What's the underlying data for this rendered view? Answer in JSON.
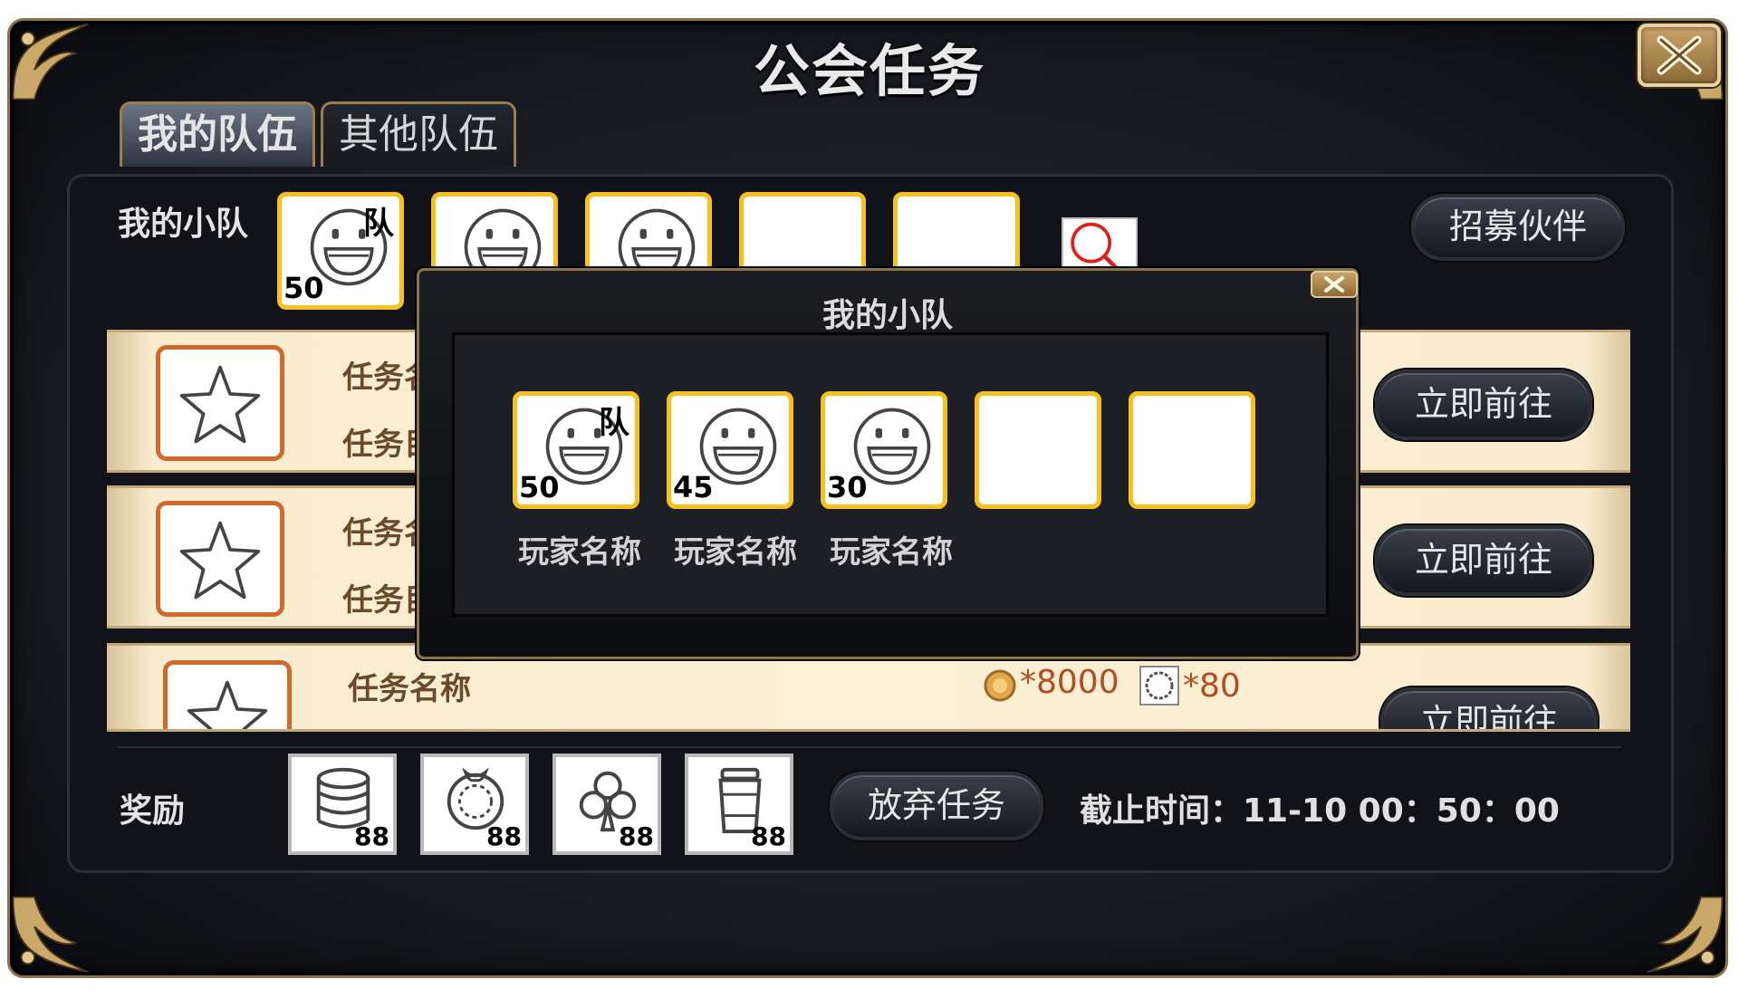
{
  "window": {
    "title": "公会任务",
    "close_icon": "close-x-icon"
  },
  "tabs": [
    {
      "label": "我的队伍",
      "active": true
    },
    {
      "label": "其他队伍",
      "active": false
    }
  ],
  "team": {
    "label": "我的小队",
    "slots": [
      {
        "level": "50",
        "captain": "队",
        "icon": "smiley-face-icon"
      },
      {
        "icon": "smiley-face-icon"
      },
      {
        "icon": "smiley-face-icon"
      },
      {},
      {}
    ],
    "search_icon": "search-icon",
    "recruit_button": "招募伙伴"
  },
  "tasks": [
    {
      "name_partial": "任务名",
      "goal_partial": "任务目",
      "button": "立即前往",
      "icon": "star-icon"
    },
    {
      "name_partial": "任务名",
      "goal_partial": "任务目",
      "button": "立即前往",
      "icon": "star-icon"
    },
    {
      "name": "任务名称",
      "coin_reward": "*8000",
      "item_reward": "*80",
      "button": "立即前往",
      "icon": "star-icon"
    }
  ],
  "rewards": {
    "label": "奖励",
    "items": [
      {
        "icon": "database-icon",
        "count": "88"
      },
      {
        "icon": "wreath-icon",
        "count": "88"
      },
      {
        "icon": "club-icon",
        "count": "88"
      },
      {
        "icon": "cup-icon",
        "count": "88"
      }
    ],
    "abandon_button": "放弃任务",
    "deadline": "截止时间：11-10 00：50：00"
  },
  "popup": {
    "title": "我的小队",
    "members": [
      {
        "level": "50",
        "captain": "队",
        "name": "玩家名称"
      },
      {
        "level": "45",
        "name": "玩家名称"
      },
      {
        "level": "30",
        "name": "玩家名称"
      },
      {},
      {}
    ]
  },
  "colors": {
    "slot_border": "#f7c021",
    "star_border": "#d0692a",
    "frame_gold": "#8a7349",
    "task_bg": "#fbefd6",
    "reward_text": "#b24c22"
  }
}
